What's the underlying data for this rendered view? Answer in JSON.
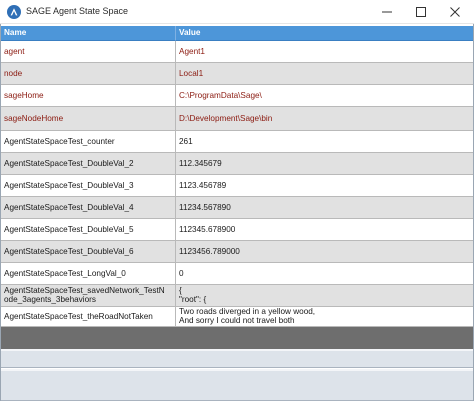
{
  "window": {
    "title": "SAGE Agent State Space",
    "icon": "sage-logo-icon"
  },
  "controls": {
    "minimize_icon": "minimize-icon",
    "maximize_icon": "maximize-icon",
    "close_icon": "close-icon"
  },
  "colors": {
    "header_bg": "#4d96d9",
    "highlight_text": "#8b1a10",
    "alt_row_bg": "#e1e1e1"
  },
  "table": {
    "columns": [
      "Name",
      "Value"
    ],
    "rows": [
      {
        "name": "agent",
        "value": "Agent1",
        "highlight": true
      },
      {
        "name": "node",
        "value": "Local1",
        "highlight": true
      },
      {
        "name": "sageHome",
        "value": "C:\\ProgramData\\Sage\\",
        "highlight": true
      },
      {
        "name": "sageNodeHome",
        "value": "D:\\Development\\Sage\\bin",
        "highlight": true
      },
      {
        "name": "AgentStateSpaceTest_counter",
        "value": "261",
        "highlight": false
      },
      {
        "name": "AgentStateSpaceTest_DoubleVal_2",
        "value": "112.345679",
        "highlight": false
      },
      {
        "name": "AgentStateSpaceTest_DoubleVal_3",
        "value": "1123.456789",
        "highlight": false
      },
      {
        "name": "AgentStateSpaceTest_DoubleVal_4",
        "value": "11234.567890",
        "highlight": false
      },
      {
        "name": "AgentStateSpaceTest_DoubleVal_5",
        "value": "112345.678900",
        "highlight": false
      },
      {
        "name": "AgentStateSpaceTest_DoubleVal_6",
        "value": "1123456.789000",
        "highlight": false
      },
      {
        "name": "AgentStateSpaceTest_LongVal_0",
        "value": "0",
        "highlight": false
      },
      {
        "name": [
          "AgentStateSpaceTest_savedNetwork_TestN",
          "ode_3agents_3behaviors"
        ],
        "value": [
          "{",
          "   \"root\": {"
        ],
        "highlight": false
      },
      {
        "name": "AgentStateSpaceTest_theRoadNotTaken",
        "value": [
          "Two roads diverged in a yellow wood,",
          "And sorry I could not travel both"
        ],
        "highlight": false
      }
    ]
  }
}
